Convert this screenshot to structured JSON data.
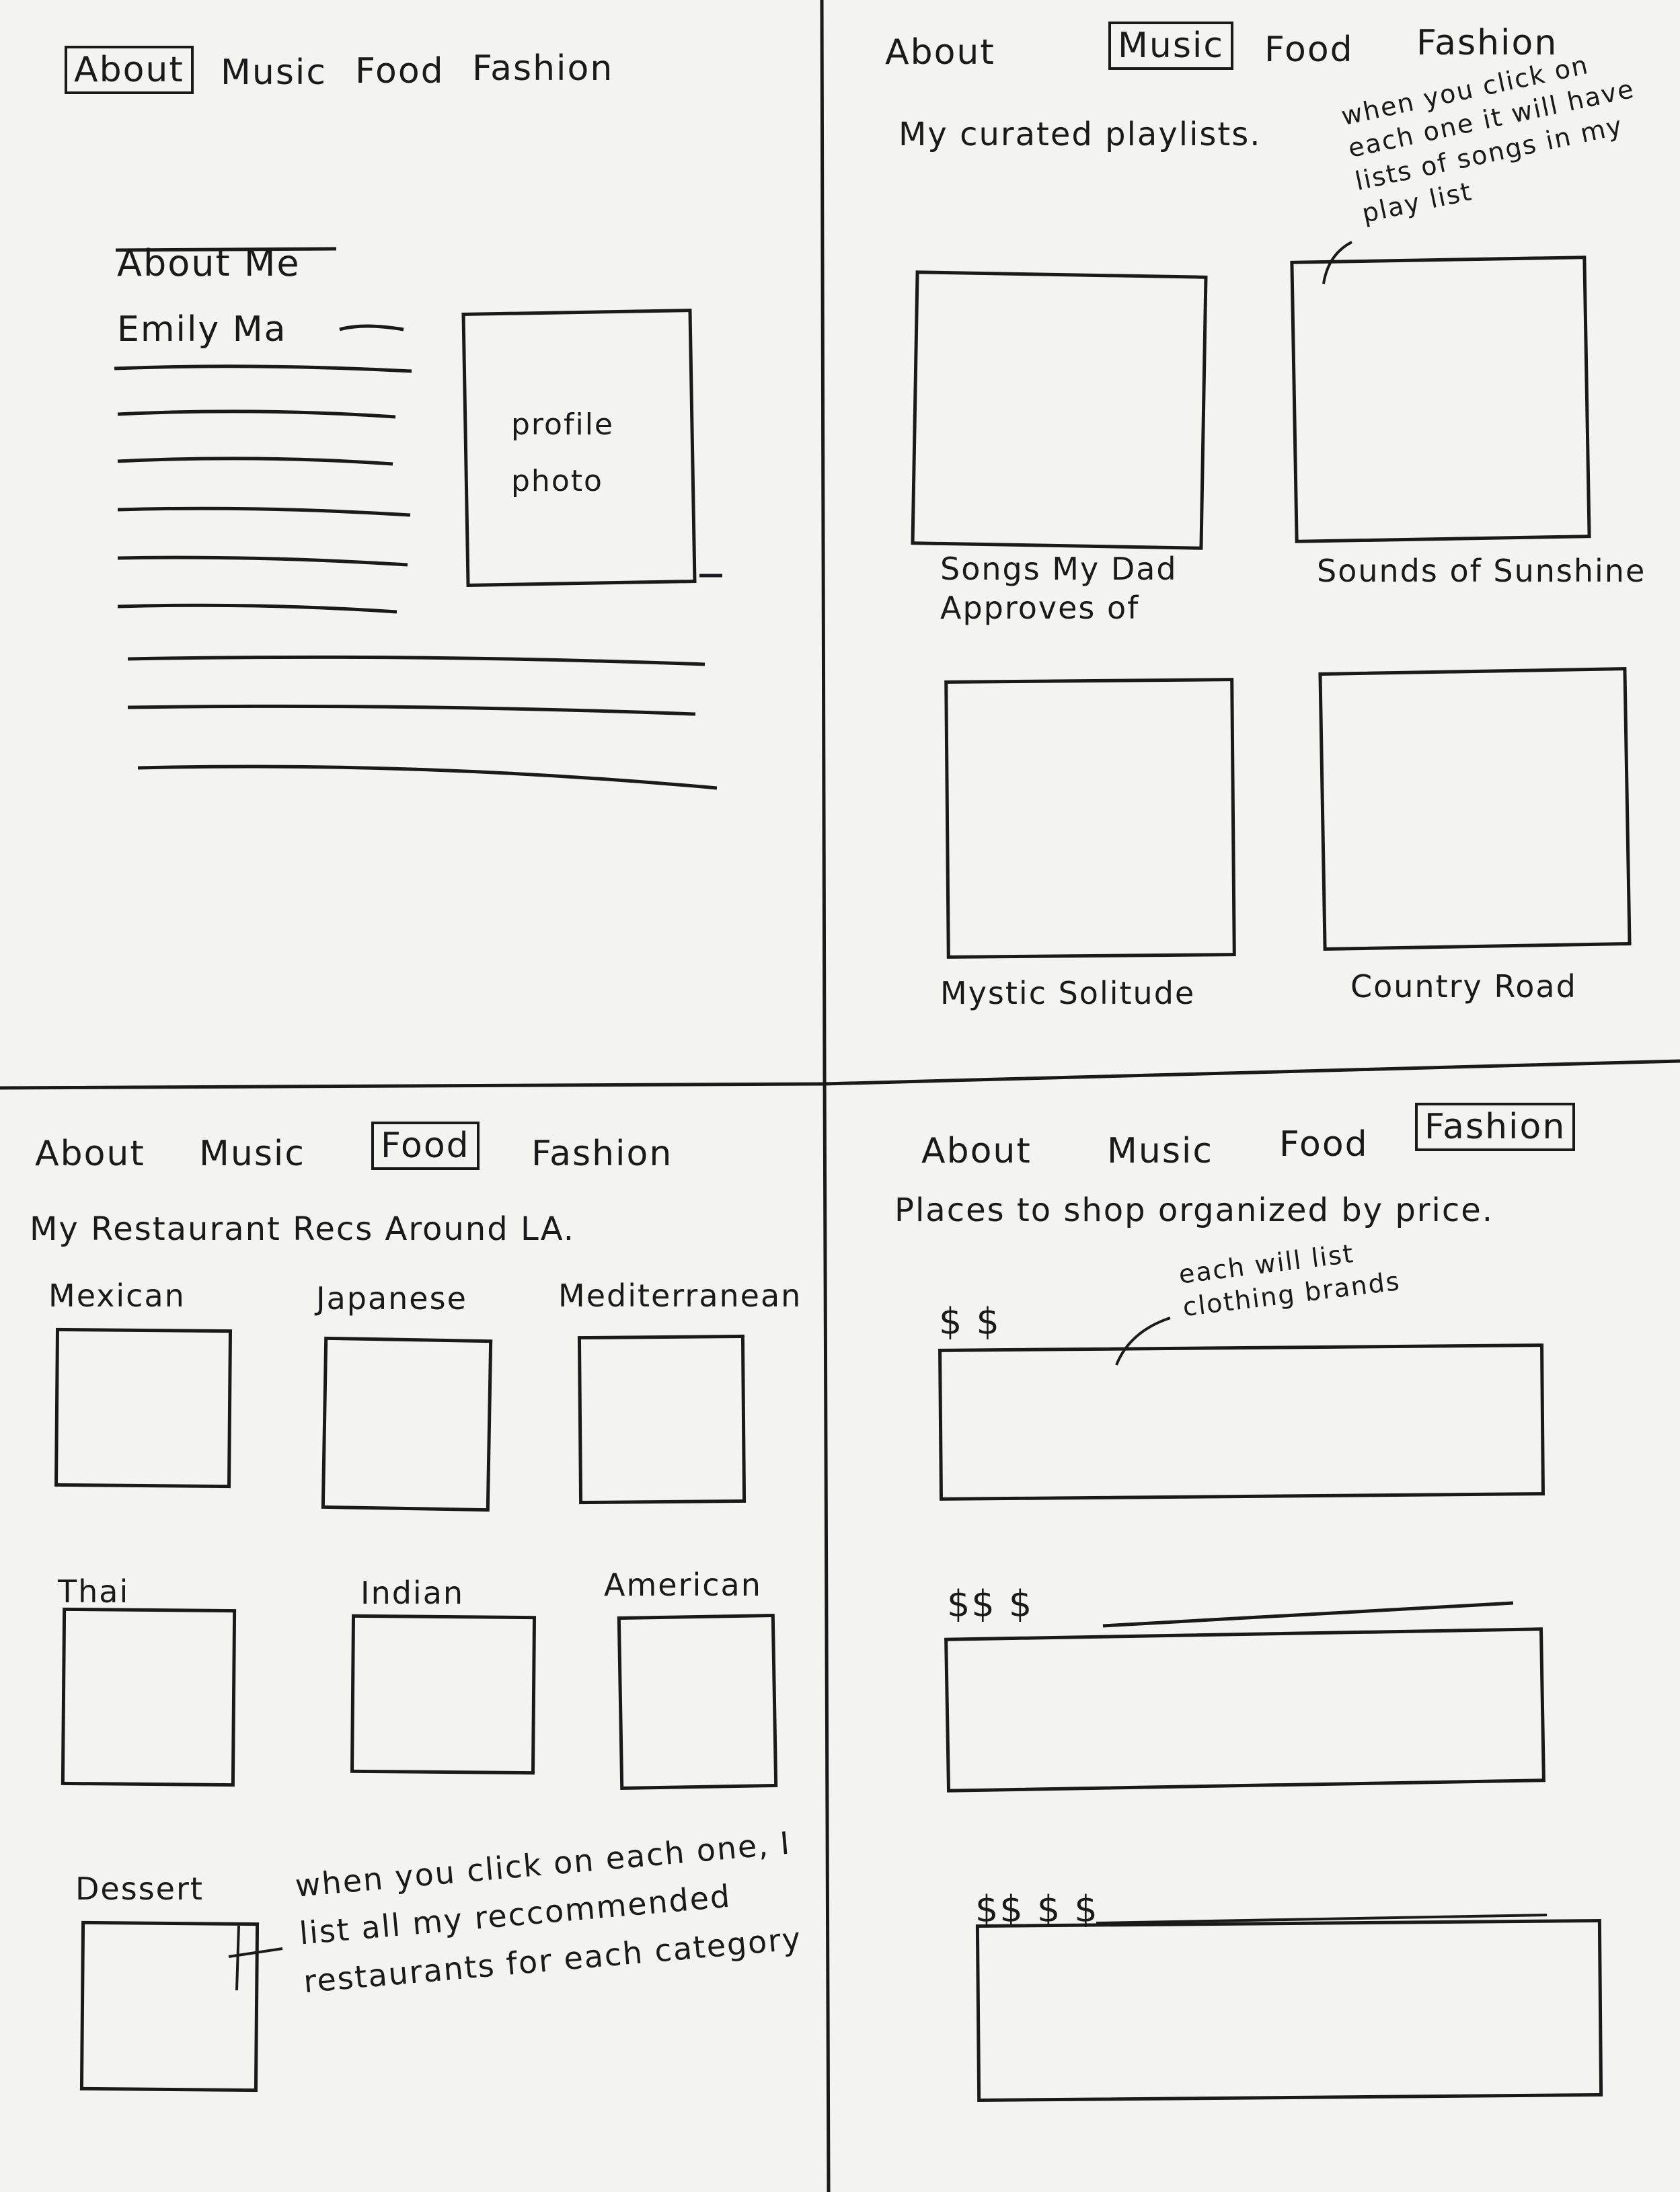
{
  "nav": {
    "about": "About",
    "music": "Music",
    "food": "Food",
    "fashion": "Fashion"
  },
  "about_page": {
    "heading": "About Me",
    "name": "Emily Ma",
    "photo_label": "profile photo"
  },
  "music_page": {
    "heading": "My curated playlists.",
    "note": "when you click on each one it will have lists of songs in my play list",
    "playlists": [
      "Songs My Dad Approves of",
      "Sounds of Sunshine",
      "Mystic Solitude",
      "Country Road"
    ]
  },
  "food_page": {
    "heading": "My Restaurant Recs Around LA.",
    "categories": [
      "Mexican",
      "Japanese",
      "Mediterranean",
      "Thai",
      "Indian",
      "American",
      "Dessert"
    ],
    "note": "when you click on each one, I list all my reccommended restaurants for each category"
  },
  "fashion_page": {
    "heading": "Places to shop organized by price.",
    "note": "each will list clothing brands",
    "tiers": [
      "$ $",
      "$$ $",
      "$$ $ $"
    ]
  }
}
